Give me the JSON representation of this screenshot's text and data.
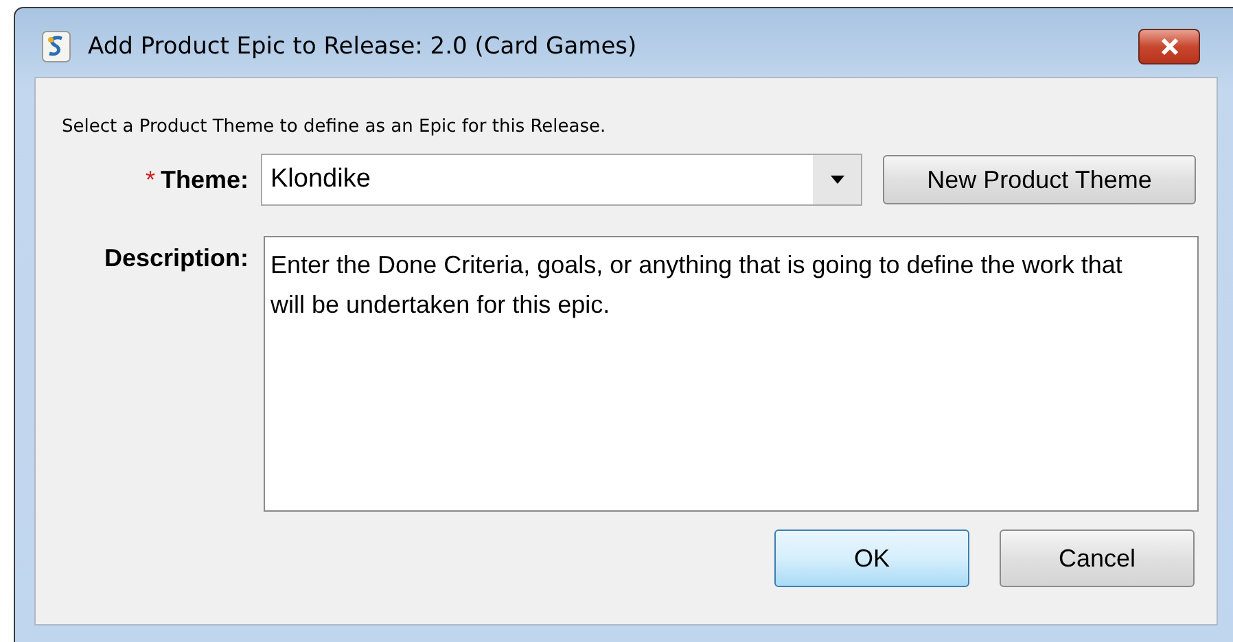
{
  "window": {
    "title": "Add Product Epic to Release: 2.0 (Card Games)"
  },
  "instruction": "Select a Product Theme to define as an Epic for this Release.",
  "theme": {
    "required_mark": "*",
    "label": "Theme:",
    "value": "Klondike",
    "new_button": "New Product Theme"
  },
  "description": {
    "label": "Description:",
    "value": "Enter the Done Criteria, goals, or anything that is going to define the work that will be undertaken for this epic."
  },
  "buttons": [
    {
      "label": "OK",
      "default": true
    },
    {
      "label": "Cancel",
      "default": false
    }
  ]
}
